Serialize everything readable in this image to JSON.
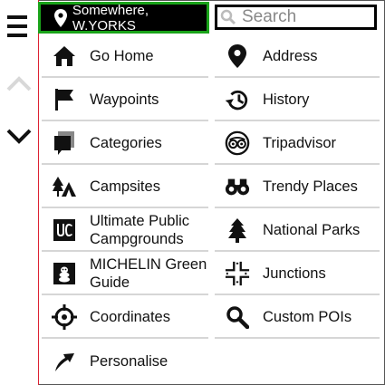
{
  "location": {
    "text": "Somewhere, W.YORKS",
    "icon": "map-pin-icon"
  },
  "search": {
    "placeholder": "Search",
    "value": "",
    "icon": "search-icon"
  },
  "rail": {
    "menu_icon": "hamburger-menu-icon",
    "up_icon": "chevron-up-icon",
    "down_icon": "chevron-down-icon"
  },
  "menu": {
    "left": [
      {
        "label": "Go Home",
        "icon": "home-icon"
      },
      {
        "label": "Waypoints",
        "icon": "flag-icon"
      },
      {
        "label": "Categories",
        "icon": "categories-icon"
      },
      {
        "label": "Campsites",
        "icon": "campsite-icon"
      },
      {
        "label": "Ultimate Public Campgrounds",
        "icon": "ultimate-campgrounds-logo-icon"
      },
      {
        "label": "MICHELIN Green Guide",
        "icon": "michelin-icon"
      },
      {
        "label": "Coordinates",
        "icon": "crosshair-icon"
      },
      {
        "label": "Personalise",
        "icon": "arrow-icon"
      }
    ],
    "right": [
      {
        "label": "Address",
        "icon": "map-pin-icon"
      },
      {
        "label": "History",
        "icon": "history-icon"
      },
      {
        "label": "Tripadvisor",
        "icon": "tripadvisor-icon"
      },
      {
        "label": "Trendy Places",
        "icon": "binoculars-icon"
      },
      {
        "label": "National Parks",
        "icon": "pine-tree-icon"
      },
      {
        "label": "Junctions",
        "icon": "junctions-icon"
      },
      {
        "label": "Custom POIs",
        "icon": "search-icon"
      }
    ]
  },
  "colors": {
    "accent_border": "#1aa31a",
    "divider": "#dd2233"
  }
}
